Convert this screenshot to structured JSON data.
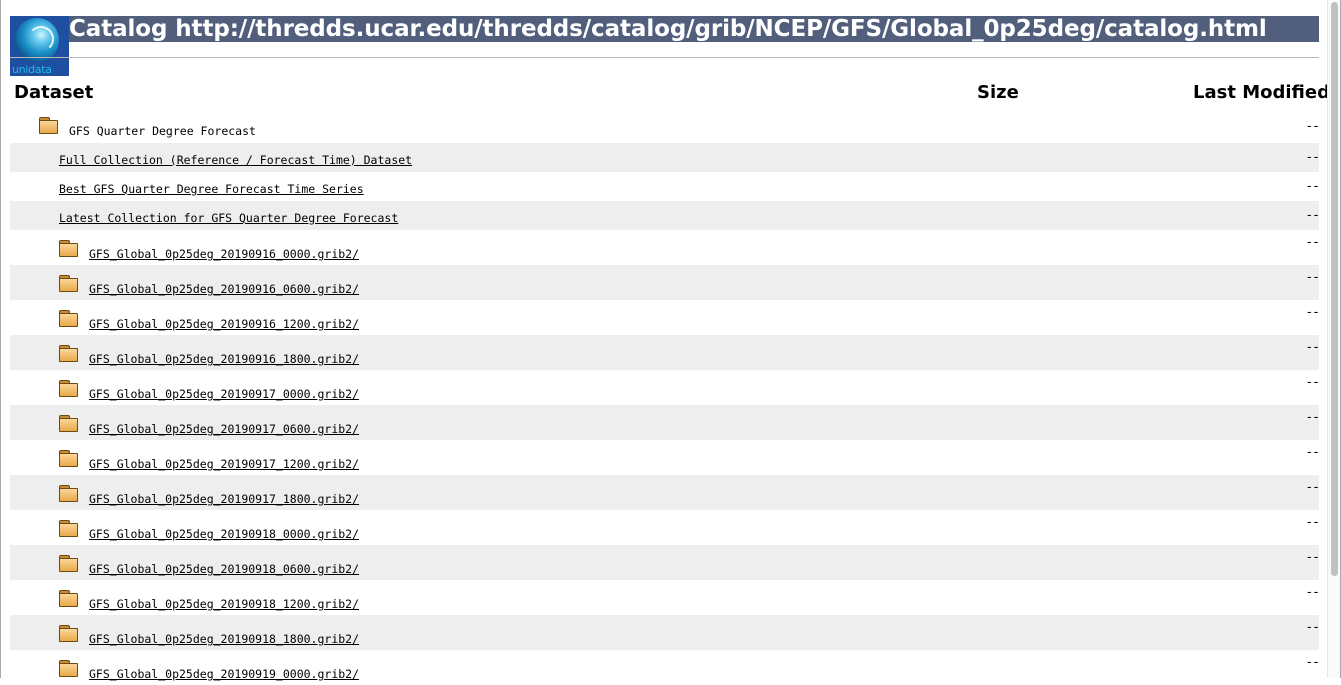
{
  "header": {
    "title": "Catalog http://thredds.ucar.edu/thredds/catalog/grib/NCEP/GFS/Global_0p25deg/catalog.html",
    "logo_text": "unidata",
    "logo_icon": "unidata-logo-icon"
  },
  "table": {
    "columns": [
      "Dataset",
      "Size",
      "Last Modified"
    ],
    "parent": {
      "label": "GFS Quarter Degree Forecast",
      "modified": "--",
      "icon": "folder-icon"
    },
    "collections": [
      {
        "label": "Full Collection (Reference / Forecast Time) Dataset",
        "modified": "--"
      },
      {
        "label": "Best GFS Quarter Degree Forecast Time Series",
        "modified": "--"
      },
      {
        "label": "Latest Collection for GFS Quarter Degree Forecast",
        "modified": "--"
      }
    ],
    "folders": [
      {
        "label": "GFS_Global_0p25deg_20190916_0000.grib2/",
        "modified": "--"
      },
      {
        "label": "GFS_Global_0p25deg_20190916_0600.grib2/",
        "modified": "--"
      },
      {
        "label": "GFS_Global_0p25deg_20190916_1200.grib2/",
        "modified": "--"
      },
      {
        "label": "GFS_Global_0p25deg_20190916_1800.grib2/",
        "modified": "--"
      },
      {
        "label": "GFS_Global_0p25deg_20190917_0000.grib2/",
        "modified": "--"
      },
      {
        "label": "GFS_Global_0p25deg_20190917_0600.grib2/",
        "modified": "--"
      },
      {
        "label": "GFS_Global_0p25deg_20190917_1200.grib2/",
        "modified": "--"
      },
      {
        "label": "GFS_Global_0p25deg_20190917_1800.grib2/",
        "modified": "--"
      },
      {
        "label": "GFS_Global_0p25deg_20190918_0000.grib2/",
        "modified": "--"
      },
      {
        "label": "GFS_Global_0p25deg_20190918_0600.grib2/",
        "modified": "--"
      },
      {
        "label": "GFS_Global_0p25deg_20190918_1200.grib2/",
        "modified": "--"
      },
      {
        "label": "GFS_Global_0p25deg_20190918_1800.grib2/",
        "modified": "--"
      },
      {
        "label": "GFS_Global_0p25deg_20190919_0000.grib2/",
        "modified": "--"
      }
    ]
  },
  "colors": {
    "title_bar": "#515f7d",
    "row_alt": "#eeeeee",
    "folder": "#f0b65a"
  }
}
